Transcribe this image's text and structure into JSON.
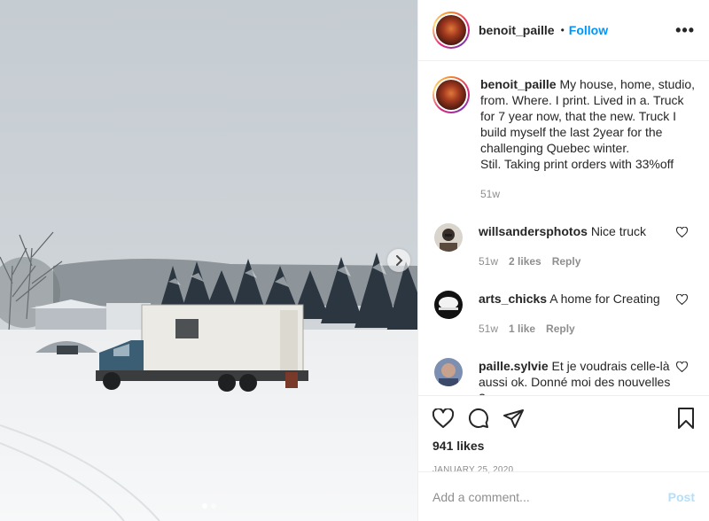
{
  "post": {
    "username": "benoit_paille",
    "follow_label": "Follow",
    "separator": "•",
    "more_label": "•••",
    "caption": "My house, home, studio, from. Where. I print. Lived in a. Truck for 7 year now, that the new. Truck I build myself the last 2year for the challenging Quebec winter.\nStil. Taking print orders with 33%off",
    "caption_age": "51w",
    "likes": "941 likes",
    "date": "JANUARY 25, 2020"
  },
  "comments": [
    {
      "username": "willsandersphotos",
      "text": "Nice truck",
      "age": "51w",
      "likes": "2 likes",
      "reply": "Reply"
    },
    {
      "username": "arts_chicks",
      "text": "A home for Creating",
      "age": "51w",
      "likes": "1 like",
      "reply": "Reply"
    },
    {
      "username": "paille.sylvie",
      "text": "Et je voudrais celle-là aussi ok. Donné moi des nouvelles ?"
    }
  ],
  "composer": {
    "placeholder": "Add a comment...",
    "post_label": "Post"
  },
  "icons": {
    "like": "heart-icon",
    "comment": "comment-icon",
    "share": "paper-plane-icon",
    "save": "bookmark-icon",
    "next": "chevron-right-icon"
  },
  "colors": {
    "accent": "#0095f6",
    "post_disabled": "#b2dffc",
    "muted": "#8e8e8e",
    "text": "#262626"
  }
}
